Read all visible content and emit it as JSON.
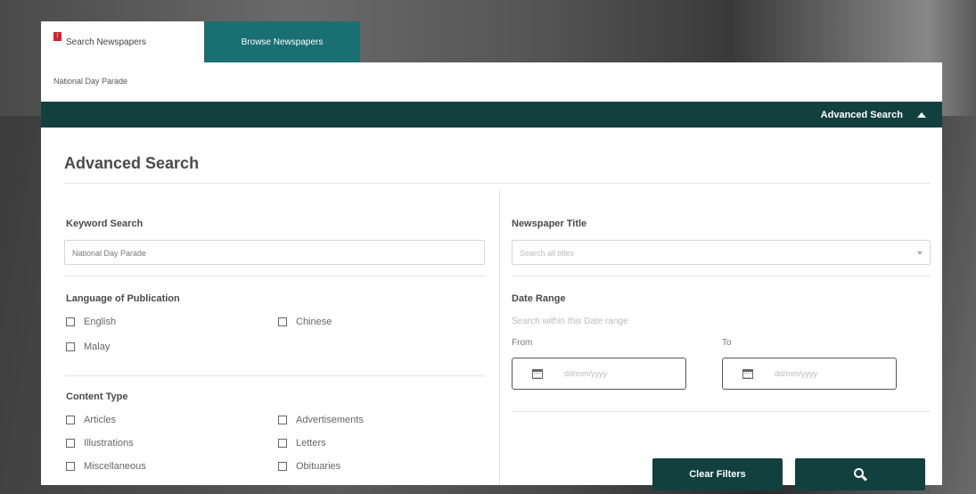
{
  "tabs": [
    {
      "label": "Search Newspapers",
      "badge": "!",
      "active": true
    },
    {
      "label": "Browse Newspapers",
      "active": false
    }
  ],
  "breadcrumb": {
    "query": "National Day Parade"
  },
  "advanced_bar": {
    "label": "Advanced Search"
  },
  "form": {
    "title": "Advanced Search",
    "keyword": {
      "label": "Keyword Search",
      "value": "National Day Parade"
    },
    "newspaper_title": {
      "label": "Newspaper Title",
      "placeholder": "Search all titles"
    },
    "language": {
      "label": "Language of Publication",
      "options": [
        "English",
        "Chinese",
        "Malay"
      ]
    },
    "date_range": {
      "label": "Date Range",
      "hint": "Search within this Date range",
      "from_label": "From",
      "to_label": "To",
      "from_placeholder": "dd/mm/yyyy",
      "to_placeholder": "dd/mm/yyyy"
    },
    "content_type": {
      "label": "Content Type",
      "options": [
        "Articles",
        "Advertisements",
        "Illustrations",
        "Letters",
        "Miscellaneous",
        "Obituaries"
      ]
    },
    "clear_button": "Clear Filters"
  },
  "colors": {
    "tab_active_bg": "#1a6f73",
    "dark_teal": "#11403f",
    "badge_red": "#d3232f"
  },
  "icons": [
    "alert-badge-icon",
    "caret-up-icon",
    "chevron-down-icon",
    "calendar-icon",
    "search-icon"
  ]
}
